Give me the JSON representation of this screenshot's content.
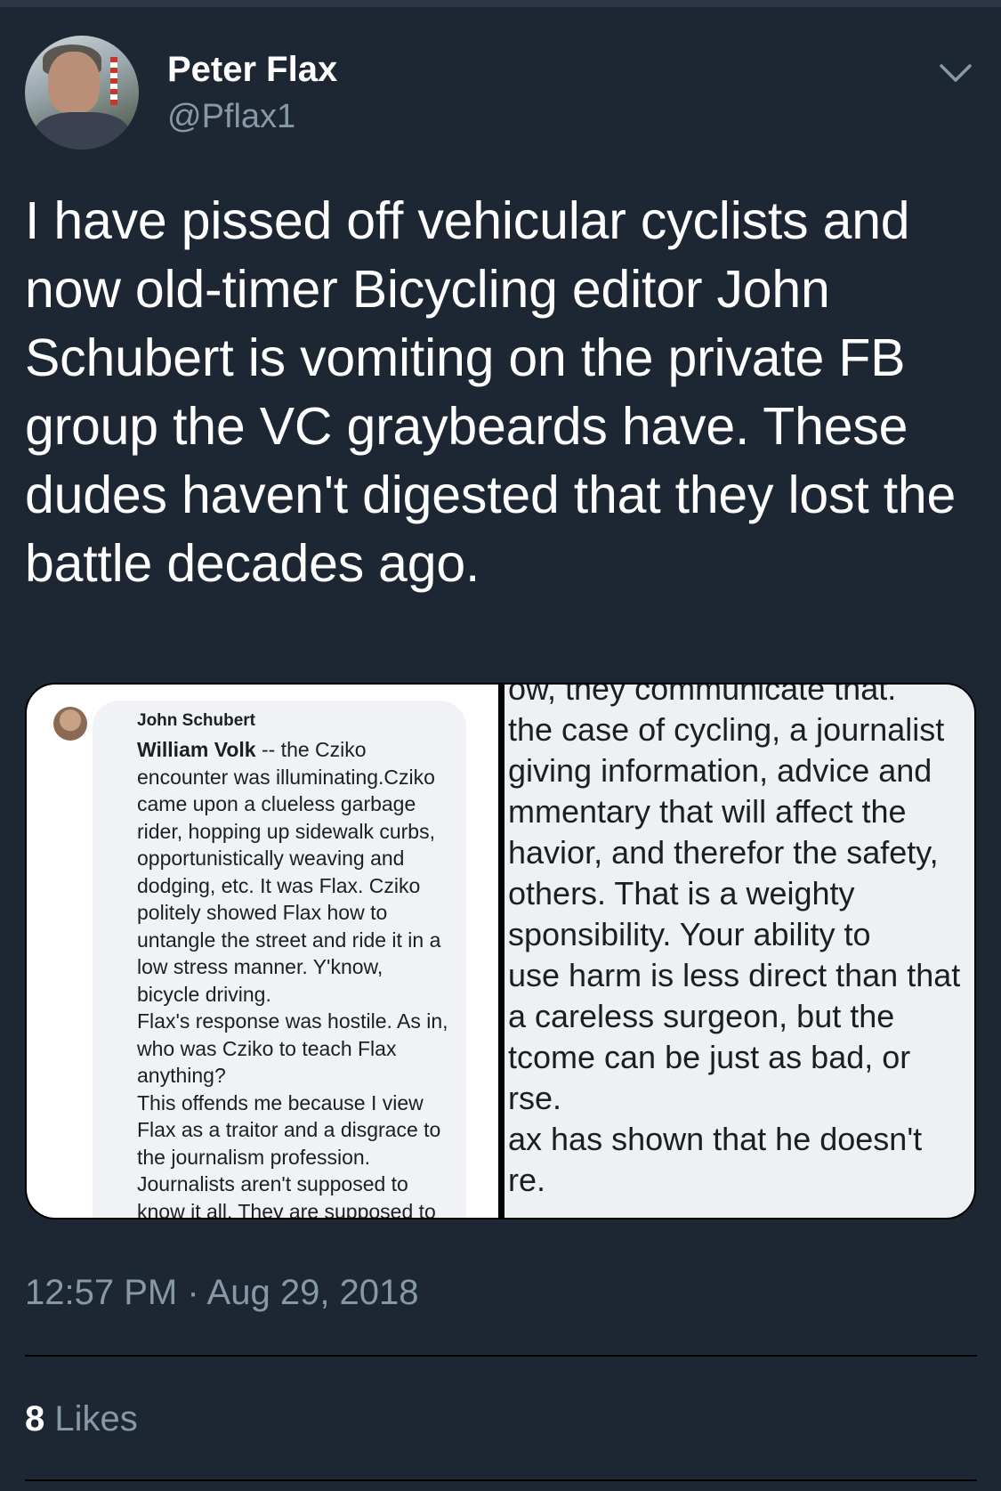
{
  "tweet": {
    "author_name": "Peter Flax",
    "author_handle": "@Pflax1",
    "text": "I have pissed off vehicular cyclists and now old-timer Bicycling editor John Schubert is vomiting on the private FB group the VC graybeards have. These dudes haven't digested that they lost the battle decades ago.",
    "timestamp": "12:57 PM · Aug 29, 2018",
    "likes_count": "8",
    "likes_label": "Likes"
  },
  "media": {
    "left": {
      "author": "John Schubert",
      "mention": "William Volk",
      "lines": [
        " -- the Cziko",
        "encounter was illuminating.Cziko",
        "came upon a clueless garbage",
        "rider, hopping up sidewalk curbs,",
        "opportunistically weaving and",
        "dodging, etc. It was Flax.  Cziko",
        "politely showed Flax how to",
        "untangle the street and ride it in a",
        "low stress manner.  Y'know,",
        "bicycle driving.",
        "Flax's response was hostile.  As in,",
        "who was Cziko to teach Flax",
        "anything?",
        "This offends me because I view",
        "Flax as a traitor and a disgrace to",
        "the journalism profession.",
        "Journalists aren't supposed to",
        "know it all.  They are supposed to"
      ]
    },
    "right": {
      "lines": [
        "ow, they communicate that.",
        "the case of cycling, a journalist",
        "giving information, advice and",
        "mmentary that will affect the",
        "havior, and therefor the safety,",
        " others.  That is a weighty",
        "sponsibility.   Your ability to",
        "use harm is less direct than that",
        " a careless surgeon, but the",
        "tcome can be just as bad, or",
        "rse.",
        "ax has shown that he doesn't",
        "re."
      ]
    }
  },
  "icons": {
    "menu": "chevron-down-icon"
  },
  "colors": {
    "background": "#1c2733",
    "secondary_text": "#8899a6",
    "primary_text": "#ffffff"
  }
}
